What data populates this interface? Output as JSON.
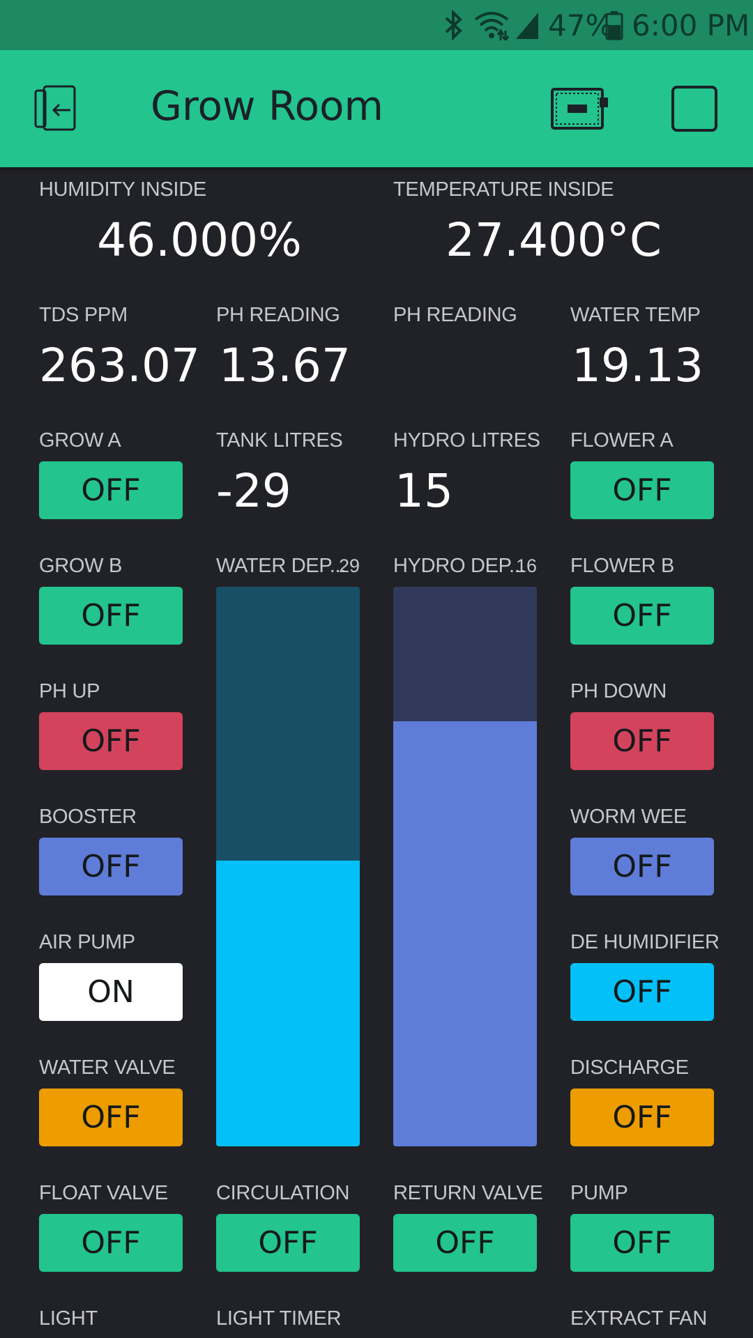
{
  "status_bar": {
    "battery_percent": "47%",
    "time": "6:00 PM",
    "icons": [
      "bluetooth-icon",
      "wifi-icon",
      "signal-icon",
      "battery-icon"
    ]
  },
  "app_bar": {
    "title": "Grow Room",
    "icons": [
      "exit-icon",
      "device-icon",
      "square-icon"
    ],
    "color": "#23c48e"
  },
  "widgets": {
    "humidity": {
      "label": "HUMIDITY INSIDE",
      "value": "46.000%"
    },
    "temperature": {
      "label": "TEMPERATURE INSIDE",
      "value": "27.400°C"
    },
    "tds": {
      "label": "TDS PPM",
      "value": "263.07"
    },
    "ph_reading_1": {
      "label": "PH READING",
      "value": "13.67"
    },
    "ph_reading_2": {
      "label": "PH READING",
      "value": ""
    },
    "water_temp": {
      "label": "WATER TEMP",
      "value": "19.13"
    },
    "tank_litres": {
      "label": "TANK LITRES",
      "value": "-29"
    },
    "hydro_litres": {
      "label": "HYDRO LITRES",
      "value": "15"
    },
    "water_depth": {
      "label": "WATER DEP...",
      "value": "29",
      "level_fraction": 0.51,
      "fill_color": "#04c0f8",
      "track_color": "#175064"
    },
    "hydro_depth": {
      "label": "HYDRO DEP...",
      "value": "16",
      "level_fraction": 0.76,
      "fill_color": "#5f7cd8",
      "track_color": "#313a5a"
    }
  },
  "buttons": {
    "grow_a": {
      "label": "GROW A",
      "state": "OFF",
      "color": "#23c48e"
    },
    "flower_a": {
      "label": "FLOWER A",
      "state": "OFF",
      "color": "#23c48e"
    },
    "grow_b": {
      "label": "GROW B",
      "state": "OFF",
      "color": "#23c48e"
    },
    "flower_b": {
      "label": "FLOWER B",
      "state": "OFF",
      "color": "#23c48e"
    },
    "ph_up": {
      "label": "PH UP",
      "state": "OFF",
      "color": "#d3435c"
    },
    "ph_down": {
      "label": "PH DOWN",
      "state": "OFF",
      "color": "#d3435c"
    },
    "booster": {
      "label": "BOOSTER",
      "state": "OFF",
      "color": "#5f7cd8"
    },
    "worm_wee": {
      "label": "WORM WEE",
      "state": "OFF",
      "color": "#5f7cd8"
    },
    "air_pump": {
      "label": "AIR PUMP",
      "state": "ON",
      "color": "#ffffff"
    },
    "de_humidifier": {
      "label": "DE HUMIDIFIER",
      "state": "OFF",
      "color": "#04c0f8"
    },
    "water_valve": {
      "label": "WATER VALVE",
      "state": "OFF",
      "color": "#ed9d00"
    },
    "discharge": {
      "label": "DISCHARGE",
      "state": "OFF",
      "color": "#ed9d00"
    },
    "float_valve": {
      "label": "FLOAT VALVE",
      "state": "OFF",
      "color": "#23c48e"
    },
    "circulation": {
      "label": "CIRCULATION",
      "state": "OFF",
      "color": "#23c48e"
    },
    "return_valve": {
      "label": "RETURN VALVE",
      "state": "OFF",
      "color": "#23c48e"
    },
    "pump": {
      "label": "PUMP",
      "state": "OFF",
      "color": "#23c48e"
    }
  },
  "bottom_labels": {
    "light": "LIGHT",
    "light_timer": "LIGHT TIMER",
    "extract_fan": "EXTRACT FAN"
  }
}
